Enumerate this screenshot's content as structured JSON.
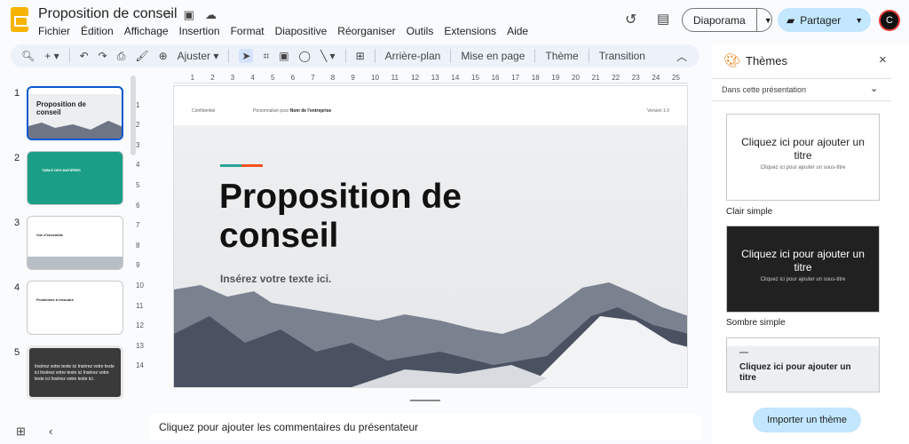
{
  "app": {
    "title": "Proposition de conseil",
    "menu": [
      "Fichier",
      "Édition",
      "Affichage",
      "Insertion",
      "Format",
      "Diapositive",
      "Réorganiser",
      "Outils",
      "Extensions",
      "Aide"
    ],
    "slideshow": "Diaporama",
    "share": "Partager",
    "avatar": "C"
  },
  "toolbar": {
    "zoom": "Ajuster",
    "background": "Arrière-plan",
    "layout": "Mise en page",
    "theme": "Thème",
    "transition": "Transition"
  },
  "filmstrip": {
    "slides": [
      {
        "num": "1",
        "title": "Proposition de conseil"
      },
      {
        "num": "2",
        "title": "TABLE DES MATIÈRES"
      },
      {
        "num": "3",
        "title": "Vue d'ensemble"
      },
      {
        "num": "4",
        "title": "Problèmes à résoudre"
      },
      {
        "num": "5",
        "title": "Insérez votre texte ici Insérez votre texte ici Insérez votre texte ici Insérez votre texte ici Insérez votre texte ici."
      }
    ]
  },
  "ruler": {
    "h": [
      "1",
      "2",
      "3",
      "4",
      "5",
      "6",
      "7",
      "8",
      "9",
      "10",
      "11",
      "12",
      "13",
      "14",
      "15",
      "16",
      "17",
      "18",
      "19",
      "20",
      "21",
      "22",
      "23",
      "24",
      "25"
    ],
    "v": [
      "1",
      "2",
      "3",
      "4",
      "5",
      "6",
      "7",
      "8",
      "9",
      "10",
      "11",
      "12",
      "13",
      "14"
    ]
  },
  "slide": {
    "confidential": "Confidentiel",
    "custom_prefix": "Personnalisé pour",
    "company": "Nom de l'entreprise",
    "version": "Version 1.0",
    "title": "Proposition de conseil",
    "subtitle": "Insérez votre texte ici.",
    "accent1": "#26a69a",
    "accent2": "#f4511e"
  },
  "notes": {
    "placeholder": "Cliquez pour ajouter les commentaires du présentateur"
  },
  "themes": {
    "header": "Thèmes",
    "section": "Dans cette présentation",
    "items": [
      {
        "title": "Cliquez ici pour ajouter un titre",
        "subtitle": "Cliquez ici pour ajouter un sous-titre",
        "name": "Clair simple"
      },
      {
        "title": "Cliquez ici pour ajouter un titre",
        "subtitle": "Cliquez ici pour ajouter un sous-titre",
        "name": "Sombre simple"
      },
      {
        "title": "Cliquez ici pour ajouter un titre"
      }
    ],
    "import": "Importer un thème"
  }
}
